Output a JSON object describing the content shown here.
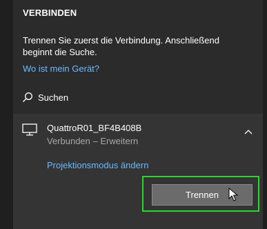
{
  "panel": {
    "title": "VERBINDEN",
    "description": "Trennen Sie zuerst die Verbindung. Anschließend beginnt die Suche.",
    "where_is_device_link": "Wo ist mein Gerät?",
    "search_label": "Suchen"
  },
  "device": {
    "icon": "monitor-icon",
    "name": "QuattroR01_BF4B408B",
    "status": "Verbunden – Erweitern",
    "projection_link": "Projektionsmodus ändern",
    "disconnect_button": "Trennen"
  },
  "colors": {
    "background": "#2b2b2b",
    "device_background": "#343434",
    "link": "#6cb8ff",
    "highlight": "#2ad82a",
    "button": "#6b6b6b"
  }
}
